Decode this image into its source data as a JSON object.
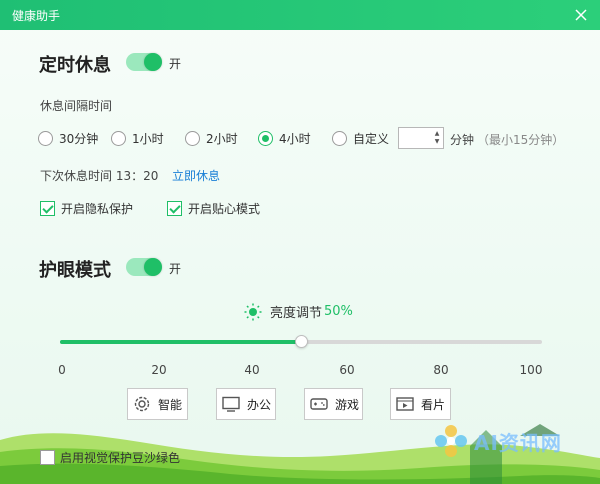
{
  "window": {
    "title": "健康助手"
  },
  "rest": {
    "title": "定时休息",
    "toggle_label": "开",
    "interval_label": "休息间隔时间",
    "options": [
      {
        "label": "30分钟",
        "selected": false
      },
      {
        "label": "1小时",
        "selected": false
      },
      {
        "label": "2小时",
        "selected": false
      },
      {
        "label": "4小时",
        "selected": true
      },
      {
        "label": "自定义",
        "selected": false
      }
    ],
    "custom_value": "",
    "custom_unit": "分钟",
    "custom_hint": "（最小15分钟）",
    "next_rest_text": "下次休息时间 13：20",
    "rest_now_link": "立即休息",
    "privacy_label": "开启隐私保护",
    "privacy_checked": true,
    "care_label": "开启贴心模式",
    "care_checked": true
  },
  "eye": {
    "title": "护眼模式",
    "toggle_label": "开",
    "brightness_label": "亮度调节",
    "brightness_value": "50%",
    "brightness_fraction": 0.5,
    "ticks": [
      "0",
      "20",
      "40",
      "60",
      "80",
      "100"
    ],
    "modes": [
      {
        "label": "智能",
        "icon": "gear-icon"
      },
      {
        "label": "办公",
        "icon": "monitor-icon"
      },
      {
        "label": "游戏",
        "icon": "gamepad-icon"
      },
      {
        "label": "看片",
        "icon": "film-icon"
      }
    ]
  },
  "footer": {
    "green_protect_label": "启用视觉保护豆沙绿色",
    "green_protect_checked": false,
    "watermark_text": "AI资讯网"
  },
  "colors": {
    "accent": "#1fbf67",
    "link": "#1a7fd6",
    "titlebar": "#22c474"
  }
}
